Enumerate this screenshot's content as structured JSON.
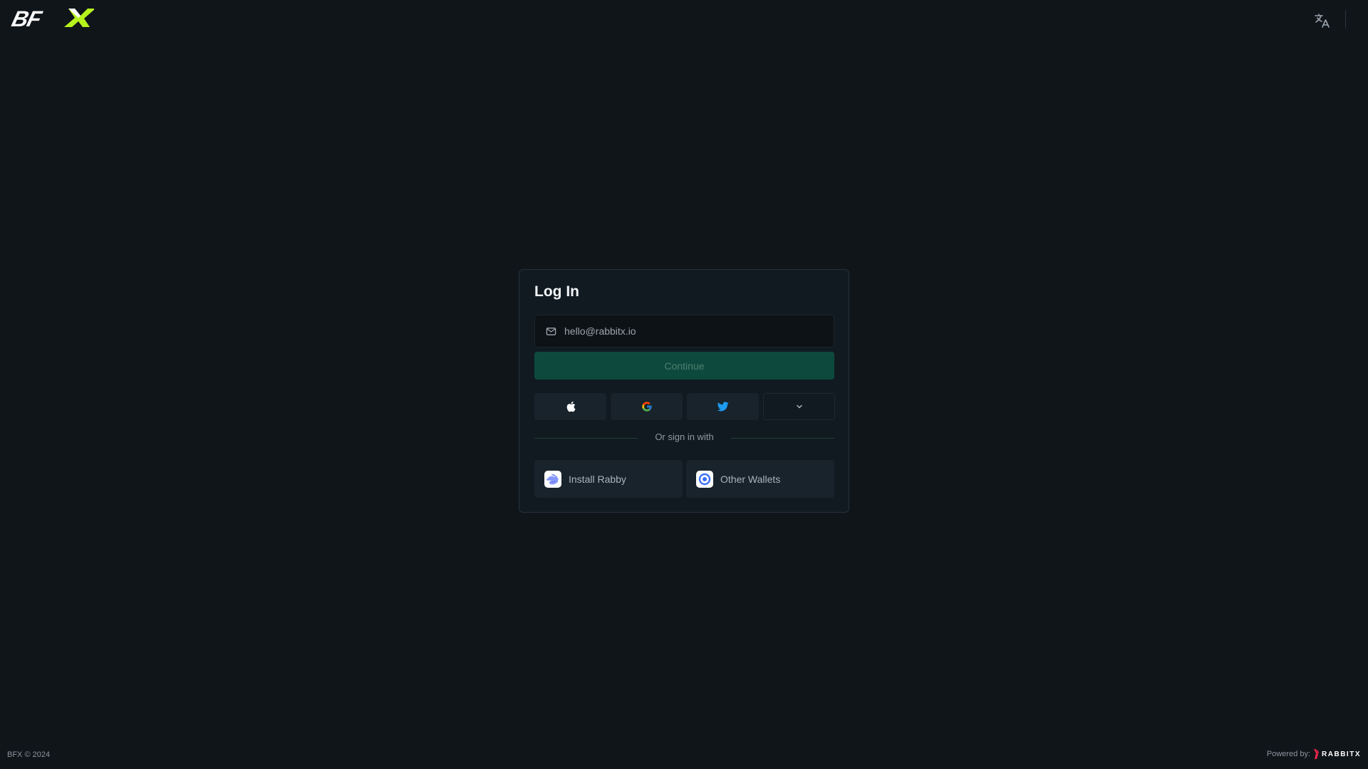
{
  "header": {
    "logo_text": "BFX",
    "language_icon": "translate-icon"
  },
  "login": {
    "title": "Log In",
    "email_placeholder": "hello@rabbitx.io",
    "email_icon": "mail-icon",
    "continue_label": "Continue",
    "social_providers": [
      {
        "name": "Apple",
        "icon": "apple-icon"
      },
      {
        "name": "Google",
        "icon": "google-icon"
      },
      {
        "name": "Twitter",
        "icon": "twitter-icon"
      },
      {
        "name": "More",
        "icon": "chevron-down-icon"
      }
    ],
    "divider_text": "Or sign in with",
    "wallets": [
      {
        "label": "Install Rabby",
        "icon": "rabby-icon"
      },
      {
        "label": "Other Wallets",
        "icon": "wallet-ring-icon"
      }
    ]
  },
  "footer": {
    "copyright": "BFX © 2024",
    "powered_by": "Powered by:",
    "powered_brand": "RABBITX"
  },
  "colors": {
    "background": "#10151a",
    "card": "#111a21",
    "accent": "#0d4a3d",
    "logo_accent": "#b6f21c"
  }
}
